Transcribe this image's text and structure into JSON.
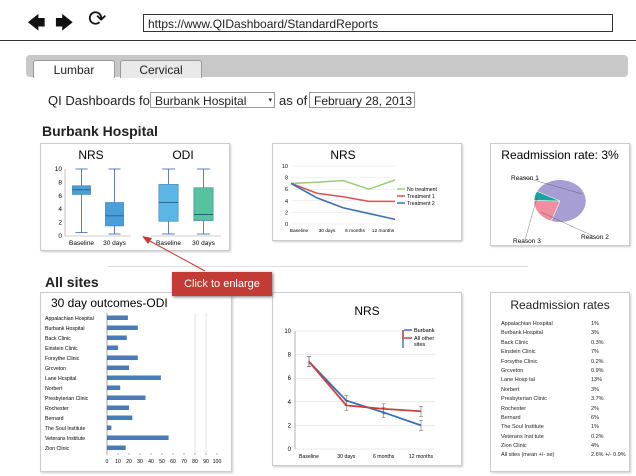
{
  "browser": {
    "url": "https://www.QIDashboard/StandardReports",
    "back_icon": "back-arrow-icon",
    "forward_icon": "forward-arrow-icon",
    "reload_icon": "reload-icon"
  },
  "tabs": [
    {
      "label": "Lumbar",
      "active": true
    },
    {
      "label": "Cervical",
      "active": false
    }
  ],
  "filter": {
    "prefix": "QI Dashboards for",
    "hospital": "Burbank Hospital",
    "as_of": "as of",
    "date": "February 28, 2013"
  },
  "hospital_section": {
    "title": "Burbank Hospital",
    "nrs_box": {
      "title": "NRS",
      "categories": [
        "Baseline",
        "30 days"
      ],
      "yticks": [
        "10",
        "8",
        "6",
        "4",
        "2",
        "0"
      ]
    },
    "odi_box": {
      "title": "ODI",
      "categories": [
        "Baseline",
        "30 days"
      ]
    },
    "nrs_line": {
      "title": "NRS",
      "yticks": [
        "10",
        "8",
        "6",
        "4",
        "2",
        "0"
      ],
      "xticks": [
        "Baseline",
        "30 days",
        "6 months",
        "12 months"
      ]
    },
    "readmission": {
      "title": "Readmission rate: 3%",
      "labels": [
        "Reason 1",
        "Reason 2",
        "Reason 3"
      ]
    }
  },
  "tooltip": {
    "text": "Click to enlarge"
  },
  "all_sites_section": {
    "title": "All sites",
    "odi_chart": {
      "title": "30 day outcomes-ODI",
      "xticks": [
        "0",
        "10",
        "20",
        "30",
        "40",
        "50",
        "60",
        "70",
        "80",
        "90",
        "100"
      ]
    },
    "nrs_chart": {
      "title": "NRS",
      "yticks": [
        "10",
        "8",
        "6",
        "4",
        "2",
        "0"
      ],
      "xticks": [
        "Baseline",
        "30 days",
        "6 months",
        "12 months"
      ]
    },
    "readmission_table": {
      "title": "Readmission rates",
      "rows": [
        {
          "site": "Appalachian Hospital",
          "rate": "1%"
        },
        {
          "site": "Burbank Hospital",
          "rate": "3%"
        },
        {
          "site": "Back Clinic",
          "rate": "0.3%"
        },
        {
          "site": "Einstein Clinic",
          "rate": "7%"
        },
        {
          "site": "Forsythe Clinic",
          "rate": "0.2%"
        },
        {
          "site": "Grcveton",
          "rate": "0.9%"
        },
        {
          "site": "Lane Hosp tal",
          "rate": "13%"
        },
        {
          "site": "Norbert",
          "rate": "3%"
        },
        {
          "site": "Presbyterian Clinic",
          "rate": "3.7%"
        },
        {
          "site": "Rochester",
          "rate": "2%"
        },
        {
          "site": "Bernard",
          "rate": "6%"
        },
        {
          "site": "The Soul Institute",
          "rate": "1%"
        },
        {
          "site": "Veterans Inst tute",
          "rate": "0.2%"
        },
        {
          "site": "Zion Clinic",
          "rate": "4%"
        },
        {
          "site": "All sites (mean +/- se)",
          "rate": "2.6% +/- 0.9%"
        }
      ]
    }
  },
  "chart_data": [
    {
      "type": "box",
      "title": "NRS",
      "categories": [
        "Baseline",
        "30 days"
      ],
      "ylim": [
        0,
        10
      ],
      "boxes": [
        {
          "min": 0.5,
          "q1": 6.2,
          "median": 6.9,
          "q3": 7.5,
          "max": 10
        },
        {
          "min": 0.3,
          "q1": 1.5,
          "median": 3,
          "q3": 5,
          "max": 10
        }
      ],
      "color": "#4a9fd8"
    },
    {
      "type": "box",
      "title": "ODI",
      "categories": [
        "Baseline",
        "30 days"
      ],
      "ylim": [
        0,
        10
      ],
      "boxes": [
        {
          "min": 0.3,
          "q1": 2.2,
          "median": 5,
          "q3": 7.7,
          "max": 10
        },
        {
          "min": 0.3,
          "q1": 2.3,
          "median": 3.2,
          "q3": 7.2,
          "max": 10
        }
      ],
      "colors": [
        "#5bb6e5",
        "#56c29e"
      ]
    },
    {
      "type": "line",
      "title": "NRS",
      "categories": [
        "Baseline",
        "30 days",
        "6 months",
        "12 months"
      ],
      "ylim": [
        0,
        10
      ],
      "x": [
        0,
        1,
        2,
        3,
        4
      ],
      "series": [
        {
          "name": "No treatment",
          "values": [
            7,
            7.2,
            7.5,
            6,
            7.6
          ],
          "color": "#9ccc7a"
        },
        {
          "name": "Treatment 1",
          "values": [
            7,
            5.3,
            4.7,
            3.9,
            3.9
          ],
          "color": "#d9534f"
        },
        {
          "name": "Treatment 2",
          "values": [
            7,
            4.5,
            2.8,
            1.8,
            0.8
          ],
          "color": "#3a6fb7"
        }
      ],
      "legend": "right"
    },
    {
      "type": "pie",
      "title": "Readmission rate: 3%",
      "categories": [
        "Reason 1",
        "Reason 2",
        "Reason 3"
      ],
      "values": [
        73,
        20,
        7
      ],
      "colors": [
        "#a79fd3",
        "#f08fa0",
        "#1aa3a0"
      ]
    },
    {
      "type": "bar",
      "orientation": "horizontal",
      "title": "30 day outcomes-ODI",
      "categories": [
        "Appalachian Hospital",
        "Burbank Hospital",
        "Back Clinic",
        "Einstein Clinic",
        "Forsythe Clinic",
        "Grcveton",
        "Lane Hcspital",
        "Norbert",
        "Presbyterian Clinic",
        "Rochester",
        "Bernard",
        "The Soul Institute",
        "Veterans Institute",
        "Zion Clinic"
      ],
      "values": [
        19,
        28,
        18,
        10,
        28,
        20,
        49,
        12,
        35,
        20,
        23,
        4,
        56,
        17
      ],
      "xlim": [
        0,
        100
      ],
      "color": "#4a7ab8"
    },
    {
      "type": "line",
      "title": "NRS",
      "categories": [
        "Baseline",
        "30 days",
        "6 months",
        "12 months"
      ],
      "ylim": [
        0,
        10
      ],
      "series": [
        {
          "name": "Burbank",
          "values": [
            7.4,
            4.1,
            3.1,
            2.0
          ],
          "color": "#3a6fb7"
        },
        {
          "name": "All other sites",
          "values": [
            7.4,
            3.7,
            3.4,
            3.2
          ],
          "color": "#c8413c"
        }
      ],
      "legend": "top-right"
    }
  ]
}
